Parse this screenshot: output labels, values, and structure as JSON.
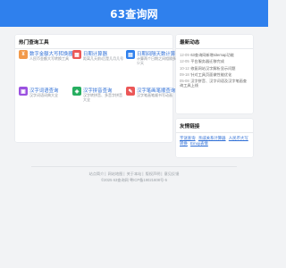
{
  "header": {
    "brand": "63查询网",
    "bg_color": "#2f80ed"
  },
  "tools_section": {
    "title": "热门查询工具",
    "items": [
      {
        "name": "数字金额大写转换器",
        "desc": "人民币金额大写转换工具",
        "icon": "yuan-icon",
        "color": "#f2994a"
      },
      {
        "name": "日期计算器",
        "desc": "距离几天前/后是几月几号",
        "icon": "calendar-icon",
        "color": "#eb5757"
      },
      {
        "name": "日期间隔天数计算器",
        "desc": "计算两个日期之间相隔多少天",
        "icon": "calendar-range-icon",
        "color": "#2f80ed"
      },
      {
        "name": "汉字词语查询",
        "desc": "汉字词语词典大全",
        "icon": "book-icon",
        "color": "#9b51e0"
      },
      {
        "name": "汉字拼音查询",
        "desc": "汉字转拼音、多音字拼音大全",
        "icon": "pinyin-icon",
        "color": "#27ae60"
      },
      {
        "name": "汉字笔画笔顺查询",
        "desc": "汉字笔画笔顺书写动画",
        "icon": "brush-icon",
        "color": "#eb5757"
      }
    ]
  },
  "news_section": {
    "title": "最新动态",
    "items": [
      {
        "date": "12-09",
        "text": "63查询网新增sitemap功能"
      },
      {
        "date": "12-05",
        "text": "平台服务器迁移完成"
      },
      {
        "date": "10-12",
        "text": "修复网站汉字解析显示问题"
      },
      {
        "date": "09-18",
        "text": "针对工具页面做性能优化"
      },
      {
        "date": "05-08",
        "text": "汉字拼音、汉字词语及汉字笔画查询工具上线"
      }
    ]
  },
  "links_section": {
    "title": "友情链接",
    "items": [
      "字谜查询",
      "亲戚关系计算器",
      "人民币大写转换",
      "Emoji表情"
    ]
  },
  "footer": {
    "nav": [
      "站点简介",
      "网站地图",
      "关于本站",
      "版权声明",
      "意见反馈"
    ],
    "copyright": "©2025 63查询网 粤ICP备19021608号-5"
  }
}
